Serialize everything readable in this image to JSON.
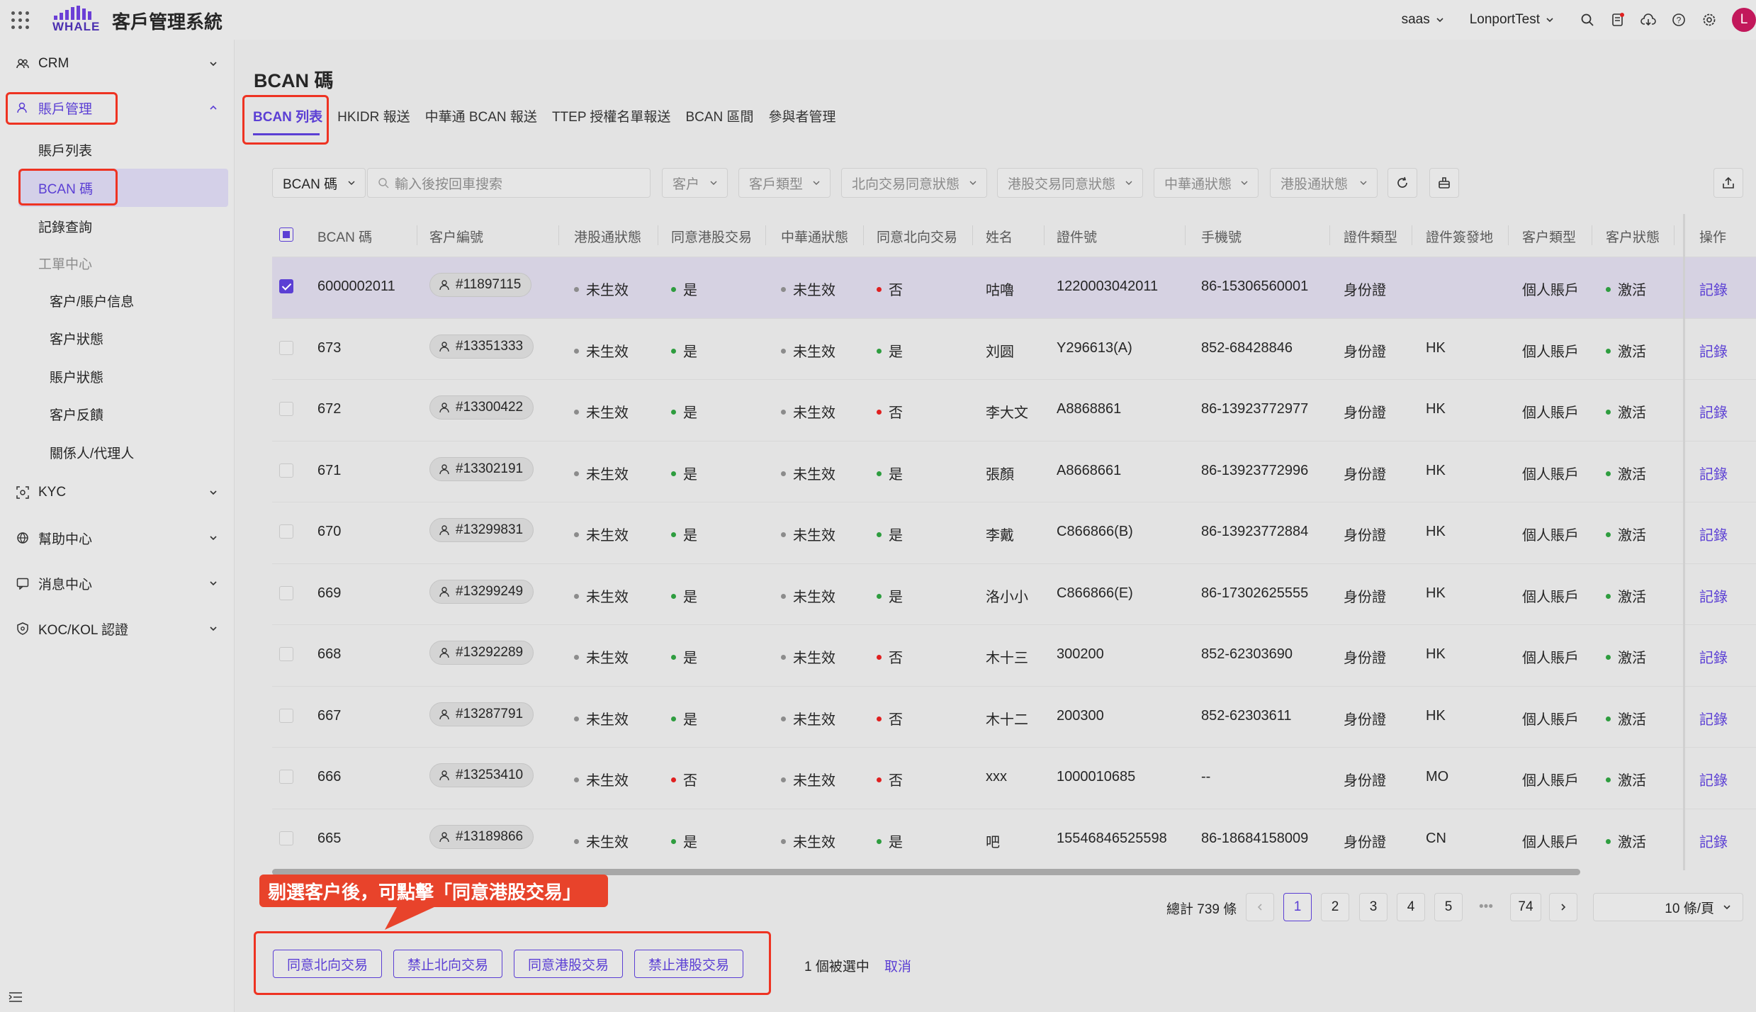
{
  "app": {
    "title": "客戶管理系統",
    "logo_text": "WHALE"
  },
  "topbar": {
    "tenant": "saas",
    "user": "LonportTest",
    "avatar_letter": "L"
  },
  "sidebar": {
    "crm": "CRM",
    "account_mgmt": "賬戶管理",
    "items": {
      "account_list": "賬戶列表",
      "bcan": "BCAN 碼",
      "record_query": "記錄查詢",
      "work_center": "工單中心"
    },
    "work_items": [
      "客户/賬户信息",
      "客户狀態",
      "賬户狀態",
      "客户反饋",
      "關係人/代理人"
    ],
    "kyc": "KYC",
    "help": "幫助中心",
    "msg": "消息中心",
    "koc": "KOC/KOL 認證"
  },
  "page": {
    "title": "BCAN 碼",
    "tabs": [
      "BCAN 列表",
      "HKIDR 報送",
      "中華通 BCAN 報送",
      "TTEP 授權名單報送",
      "BCAN 區間",
      "參與者管理"
    ]
  },
  "filters": {
    "bcan_select": "BCAN 碼",
    "search_placeholder": "輸入後按回車搜索",
    "customer": "客户",
    "customer_type": "客戶類型",
    "northbound": "北向交易同意狀態",
    "hk_trade": "港股交易同意狀態",
    "zht_status": "中華通狀態",
    "hk_status": "港股通狀態"
  },
  "table": {
    "headers": [
      "BCAN 碼",
      "客户編號",
      "港股通狀態",
      "同意港股交易",
      "中華通狀態",
      "同意北向交易",
      "姓名",
      "證件號",
      "手機號",
      "證件類型",
      "證件簽發地",
      "客户類型",
      "客户狀態",
      "操作"
    ],
    "rows": [
      {
        "bcan": "6000002011",
        "cust": "#11897115",
        "hk": "未生效",
        "agree_hk": "是",
        "zht": "未生效",
        "north": "否",
        "name": "咕嚕",
        "id": "1220003042011",
        "phone": "86-15306560001",
        "idtype": "身份證",
        "place": "",
        "ctype": "個人賬戶",
        "status": "激活",
        "op": "記錄"
      },
      {
        "bcan": "673",
        "cust": "#13351333",
        "hk": "未生效",
        "agree_hk": "是",
        "zht": "未生效",
        "north": "是",
        "name": "刘圆",
        "id": "Y296613(A)",
        "phone": "852-68428846",
        "idtype": "身份證",
        "place": "HK",
        "ctype": "個人賬戶",
        "status": "激活",
        "op": "記錄"
      },
      {
        "bcan": "672",
        "cust": "#13300422",
        "hk": "未生效",
        "agree_hk": "是",
        "zht": "未生效",
        "north": "否",
        "name": "李大文",
        "id": "A8868861",
        "phone": "86-13923772977",
        "idtype": "身份證",
        "place": "HK",
        "ctype": "個人賬戶",
        "status": "激活",
        "op": "記錄"
      },
      {
        "bcan": "671",
        "cust": "#13302191",
        "hk": "未生效",
        "agree_hk": "是",
        "zht": "未生效",
        "north": "是",
        "name": "張顏",
        "id": "A8668661",
        "phone": "86-13923772996",
        "idtype": "身份證",
        "place": "HK",
        "ctype": "個人賬戶",
        "status": "激活",
        "op": "記錄"
      },
      {
        "bcan": "670",
        "cust": "#13299831",
        "hk": "未生效",
        "agree_hk": "是",
        "zht": "未生效",
        "north": "是",
        "name": "李戴",
        "id": "C866866(B)",
        "phone": "86-13923772884",
        "idtype": "身份證",
        "place": "HK",
        "ctype": "個人賬戶",
        "status": "激活",
        "op": "記錄"
      },
      {
        "bcan": "669",
        "cust": "#13299249",
        "hk": "未生效",
        "agree_hk": "是",
        "zht": "未生效",
        "north": "是",
        "name": "洛小小",
        "id": "C866866(E)",
        "phone": "86-17302625555",
        "idtype": "身份證",
        "place": "HK",
        "ctype": "個人賬戶",
        "status": "激活",
        "op": "記錄"
      },
      {
        "bcan": "668",
        "cust": "#13292289",
        "hk": "未生效",
        "agree_hk": "是",
        "zht": "未生效",
        "north": "否",
        "name": "木十三",
        "id": "300200",
        "phone": "852-62303690",
        "idtype": "身份證",
        "place": "HK",
        "ctype": "個人賬戶",
        "status": "激活",
        "op": "記錄"
      },
      {
        "bcan": "667",
        "cust": "#13287791",
        "hk": "未生效",
        "agree_hk": "是",
        "zht": "未生效",
        "north": "否",
        "name": "木十二",
        "id": "200300",
        "phone": "852-62303611",
        "idtype": "身份證",
        "place": "HK",
        "ctype": "個人賬戶",
        "status": "激活",
        "op": "記錄"
      },
      {
        "bcan": "666",
        "cust": "#13253410",
        "hk": "未生效",
        "agree_hk": "否",
        "zht": "未生效",
        "north": "否",
        "name": "xxx",
        "id": "1000010685",
        "phone": "--",
        "idtype": "身份證",
        "place": "MO",
        "ctype": "個人賬戶",
        "status": "激活",
        "op": "記錄"
      },
      {
        "bcan": "665",
        "cust": "#13189866",
        "hk": "未生效",
        "agree_hk": "是",
        "zht": "未生效",
        "north": "是",
        "name": "吧",
        "id": "15546846525598",
        "phone": "86-18684158009",
        "idtype": "身份證",
        "place": "CN",
        "ctype": "個人賬戶",
        "status": "激活",
        "op": "記錄"
      }
    ]
  },
  "pagination": {
    "total": "總計 739 條",
    "pages": [
      "1",
      "2",
      "3",
      "4",
      "5"
    ],
    "ellipsis": "•••",
    "last": "74",
    "page_size": "10 條/頁",
    "current": "1"
  },
  "callout": "剔選客户後，可點擊「同意港股交易」",
  "bulk": {
    "buttons": [
      "同意北向交易",
      "禁止北向交易",
      "同意港股交易",
      "禁止港股交易"
    ],
    "selected": "1 個被選中",
    "cancel": "取消"
  },
  "colors": {
    "accent": "#5b3fd4",
    "annotation_red": "#e8432b",
    "ok_green": "#2e9d3f",
    "no_red": "#e02020"
  }
}
